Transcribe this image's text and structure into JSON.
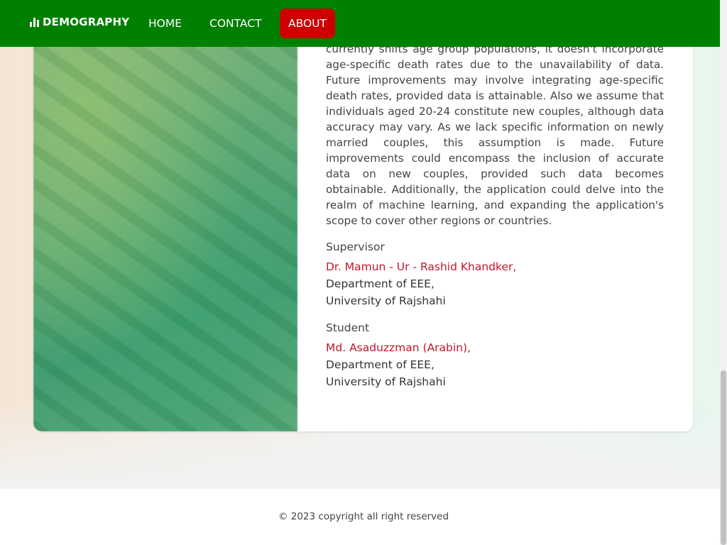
{
  "navbar": {
    "brand": "DEMOGRAPHY",
    "brand_icon": "bar-chart-icon",
    "links": [
      "HOME",
      "CONTACT",
      "ABOUT"
    ],
    "active_link": "ABOUT",
    "background_color": "#008000",
    "active_color": "#cc0000"
  },
  "about": {
    "paragraph": "currently shifts age group populations, it doesn't incorporate age-specific death rates due to the unavailability of data. Future improvements may involve integrating age-specific death rates, provided data is attainable. Also we assume that individuals aged 20-24 constitute new couples, although data accuracy may vary. As we lack specific information on newly married couples, this assumption is made. Future improvements could encompass the inclusion of accurate data on new couples, provided such data becomes obtainable. Additionally, the application could delve into the realm of machine learning, and expanding the application's scope to cover other regions or countries.",
    "supervisor": {
      "label": "Supervisor",
      "name": "Dr. Mamun - Ur - Rashid Khandker,",
      "department": "Department of EEE,",
      "university": "University of Rajshahi"
    },
    "student": {
      "label": "Student",
      "name": "Md. Asaduzzman (Arabin),",
      "department": "Department of EEE,",
      "university": "University of Rajshahi"
    },
    "name_color": "#c0182b"
  },
  "footer": {
    "copyright": "© 2023 copyright all right reserved"
  }
}
